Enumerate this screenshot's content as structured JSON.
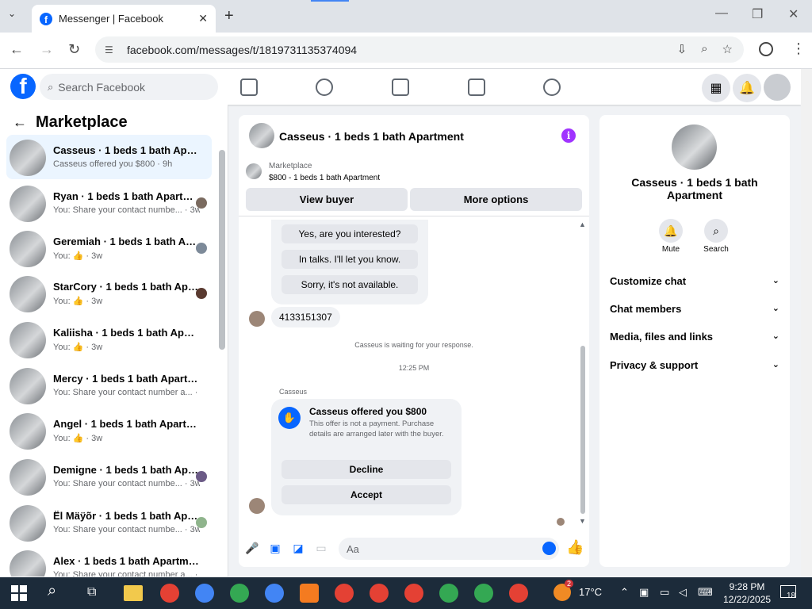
{
  "browser": {
    "tab_title": "Messenger | Facebook",
    "url": "facebook.com/messages/t/1819731135374094"
  },
  "fb": {
    "search_placeholder": "Search Facebook"
  },
  "left": {
    "title": "Marketplace",
    "conversations": [
      {
        "name": "Casseus · 1 beds 1 bath Apartme...",
        "preview": "Casseus offered you $800 · 9h"
      },
      {
        "name": "Ryan · 1 beds 1 bath Apartment",
        "preview": "You: Share your contact numbe... · 3w"
      },
      {
        "name": "Geremiah · 1 beds 1 bath Apa...",
        "preview": "You: 👍 · 3w"
      },
      {
        "name": "StarCory · 1 beds 1 bath Apart...",
        "preview": "You: 👍 · 3w"
      },
      {
        "name": "Kaliisha · 1 beds 1 bath Apartment",
        "preview": "You: 👍 · 3w"
      },
      {
        "name": "Mercy · 1 beds 1 bath Apartment",
        "preview": "You: Share your contact number a... · 3w"
      },
      {
        "name": "Angel · 1 beds 1 bath Apartment",
        "preview": "You: 👍 · 3w"
      },
      {
        "name": "Demigne · 1 beds 1 bath Apar...",
        "preview": "You: Share your contact numbe... · 3w"
      },
      {
        "name": "Ël Mäÿõr · 1 beds 1 bath Apar...",
        "preview": "You: Share your contact numbe... · 3w"
      },
      {
        "name": "Alex · 1 beds 1 bath Apartment",
        "preview": "You: Share your contact number a... · 3w"
      }
    ]
  },
  "chat": {
    "title": "Casseus · 1 beds 1 bath Apartment",
    "marketplace_label": "Marketplace",
    "marketplace_sub": "$800 - 1 beds 1 bath Apartment",
    "view_buyer": "View buyer",
    "more_options": "More options",
    "quick_replies": [
      "Yes, are you interested?",
      "In talks. I'll let you know.",
      "Sorry, it's not available."
    ],
    "phone_msg": "4133151307",
    "waiting": "Casseus is waiting for your response.",
    "time": "12:25 PM",
    "sender": "Casseus",
    "offer_title": "Casseus offered you $800",
    "offer_desc": "This offer is not a payment. Purchase details are arranged later with the buyer.",
    "decline": "Decline",
    "accept": "Accept",
    "composer_placeholder": "Aa"
  },
  "right": {
    "name": "Casseus · 1 beds 1 bath Apartment",
    "mute": "Mute",
    "search": "Search",
    "sections": [
      "Customize chat",
      "Chat members",
      "Media, files and links",
      "Privacy & support"
    ]
  },
  "taskbar": {
    "temp": "17°C",
    "time": "9:28 PM",
    "date": "12/22/2025",
    "badge": "2",
    "notif": "18"
  }
}
